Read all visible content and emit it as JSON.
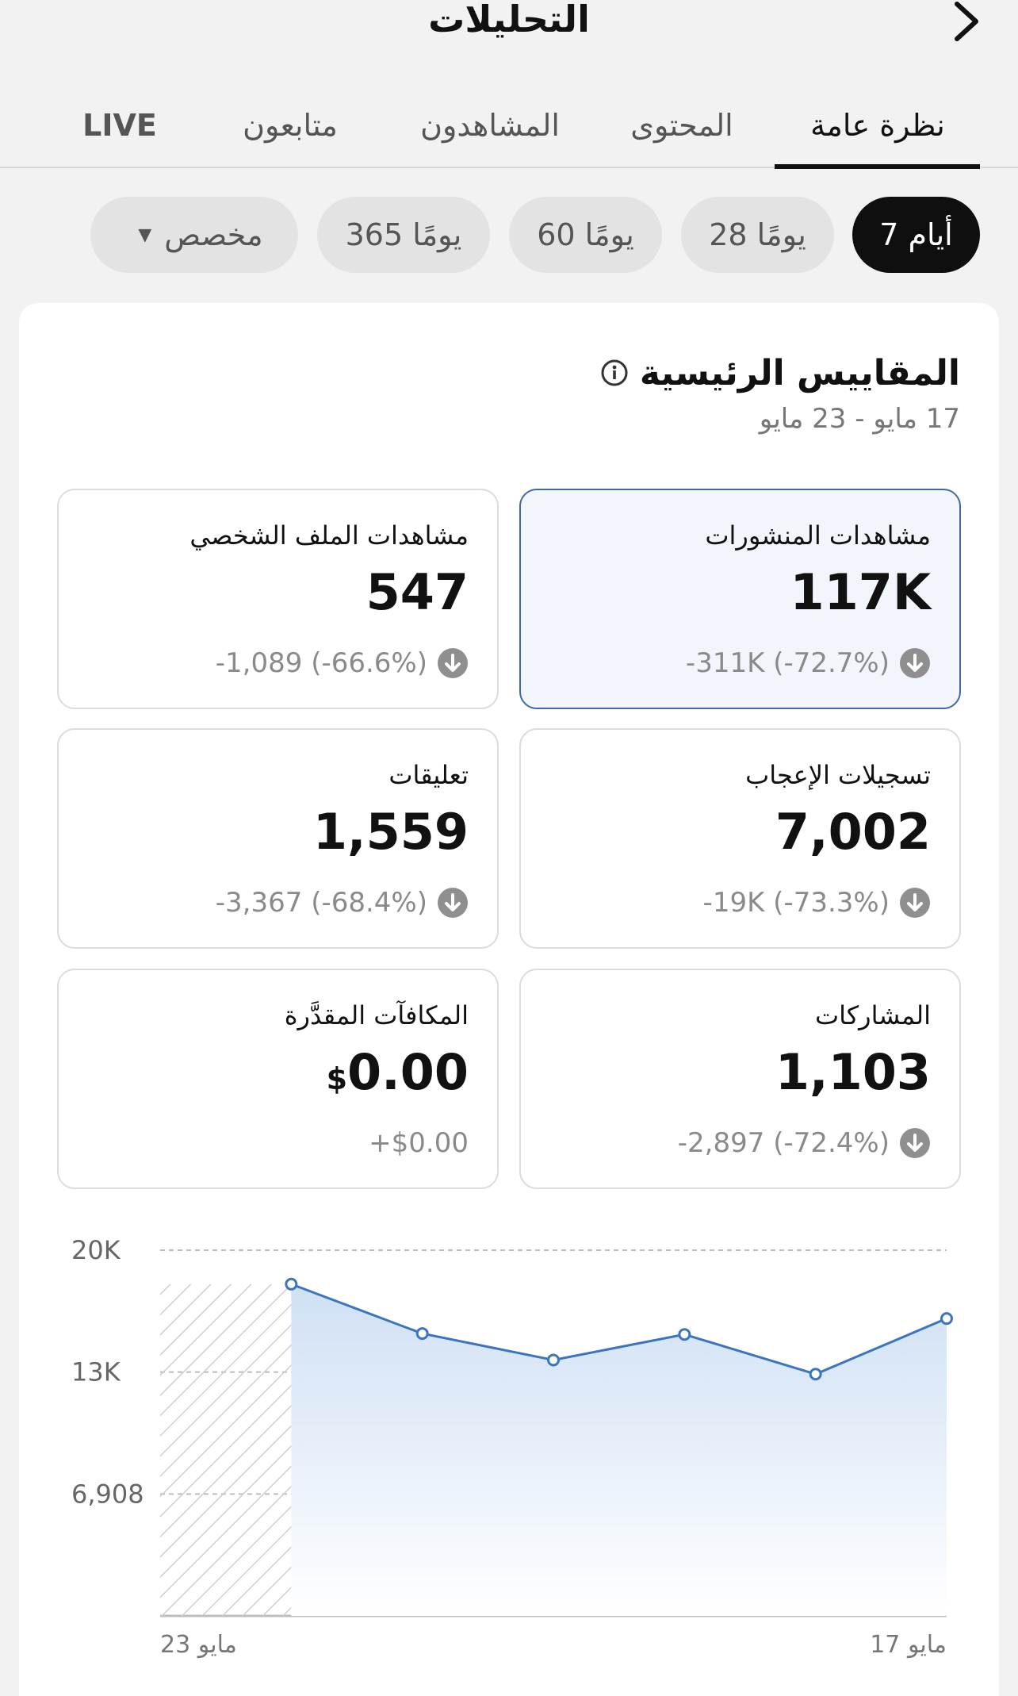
{
  "header": {
    "title": "التحليلات"
  },
  "tabs": [
    {
      "label": "نظرة عامة",
      "active": true
    },
    {
      "label": "المحتوى"
    },
    {
      "label": "المشاهدون"
    },
    {
      "label": "متابعون"
    },
    {
      "label": "LIVE"
    }
  ],
  "date_filters": [
    {
      "label": "7 أيام",
      "active": true
    },
    {
      "label": "28 يومًا"
    },
    {
      "label": "60 يومًا"
    },
    {
      "label": "365 يومًا"
    },
    {
      "label": "مخصص",
      "dropdown": true
    }
  ],
  "section": {
    "title": "المقاييس الرئيسية",
    "date_range": "17 مايو - 23 مايو"
  },
  "metrics": [
    {
      "label": "مشاهدات المنشورات",
      "value": "117K",
      "change": "-311K (-72.7%)",
      "selected": true
    },
    {
      "label": "مشاهدات الملف الشخصي",
      "value": "547",
      "change": "-1,089 (-66.6%)"
    },
    {
      "label": "تسجيلات الإعجاب",
      "value": "7,002",
      "change": "-19K (-73.3%)"
    },
    {
      "label": "تعليقات",
      "value": "1,559",
      "change": "-3,367 (-68.4%)"
    },
    {
      "label": "المشاركات",
      "value": "1,103",
      "change": "-2,897 (-72.4%)"
    },
    {
      "label": "المكافآت المقدَّرة",
      "value": "0.00",
      "currency": "$",
      "change": "+$0.00"
    }
  ],
  "chart_data": {
    "type": "area",
    "x": [
      "17 مايو",
      "",
      "",
      "",
      "",
      "",
      "23 مايو"
    ],
    "x_tick_labels": [
      "23 مايو",
      "17 مايو"
    ],
    "y_ticks": [
      "20K",
      "13K",
      "6,908"
    ],
    "y_tick_values": [
      20724,
      13816,
      6908
    ],
    "ylim": [
      0,
      20724
    ],
    "values": [
      16850,
      13700,
      15950,
      14500,
      16000,
      18800,
      16800
    ],
    "hatched_points": 1,
    "grid": true,
    "colors": {
      "line": "#3b74c0",
      "fill": "#cfe0f4",
      "grid": "#bdbdbd",
      "hatch": "#cfcfcf"
    }
  },
  "colors": {
    "accent": "#3f6aa6",
    "selected_card_bg": "#f2f6fc",
    "active_chip_bg": "#0f0f0f",
    "muted_text": "#8a8a8a",
    "down_icon": "#8f8f8f"
  }
}
